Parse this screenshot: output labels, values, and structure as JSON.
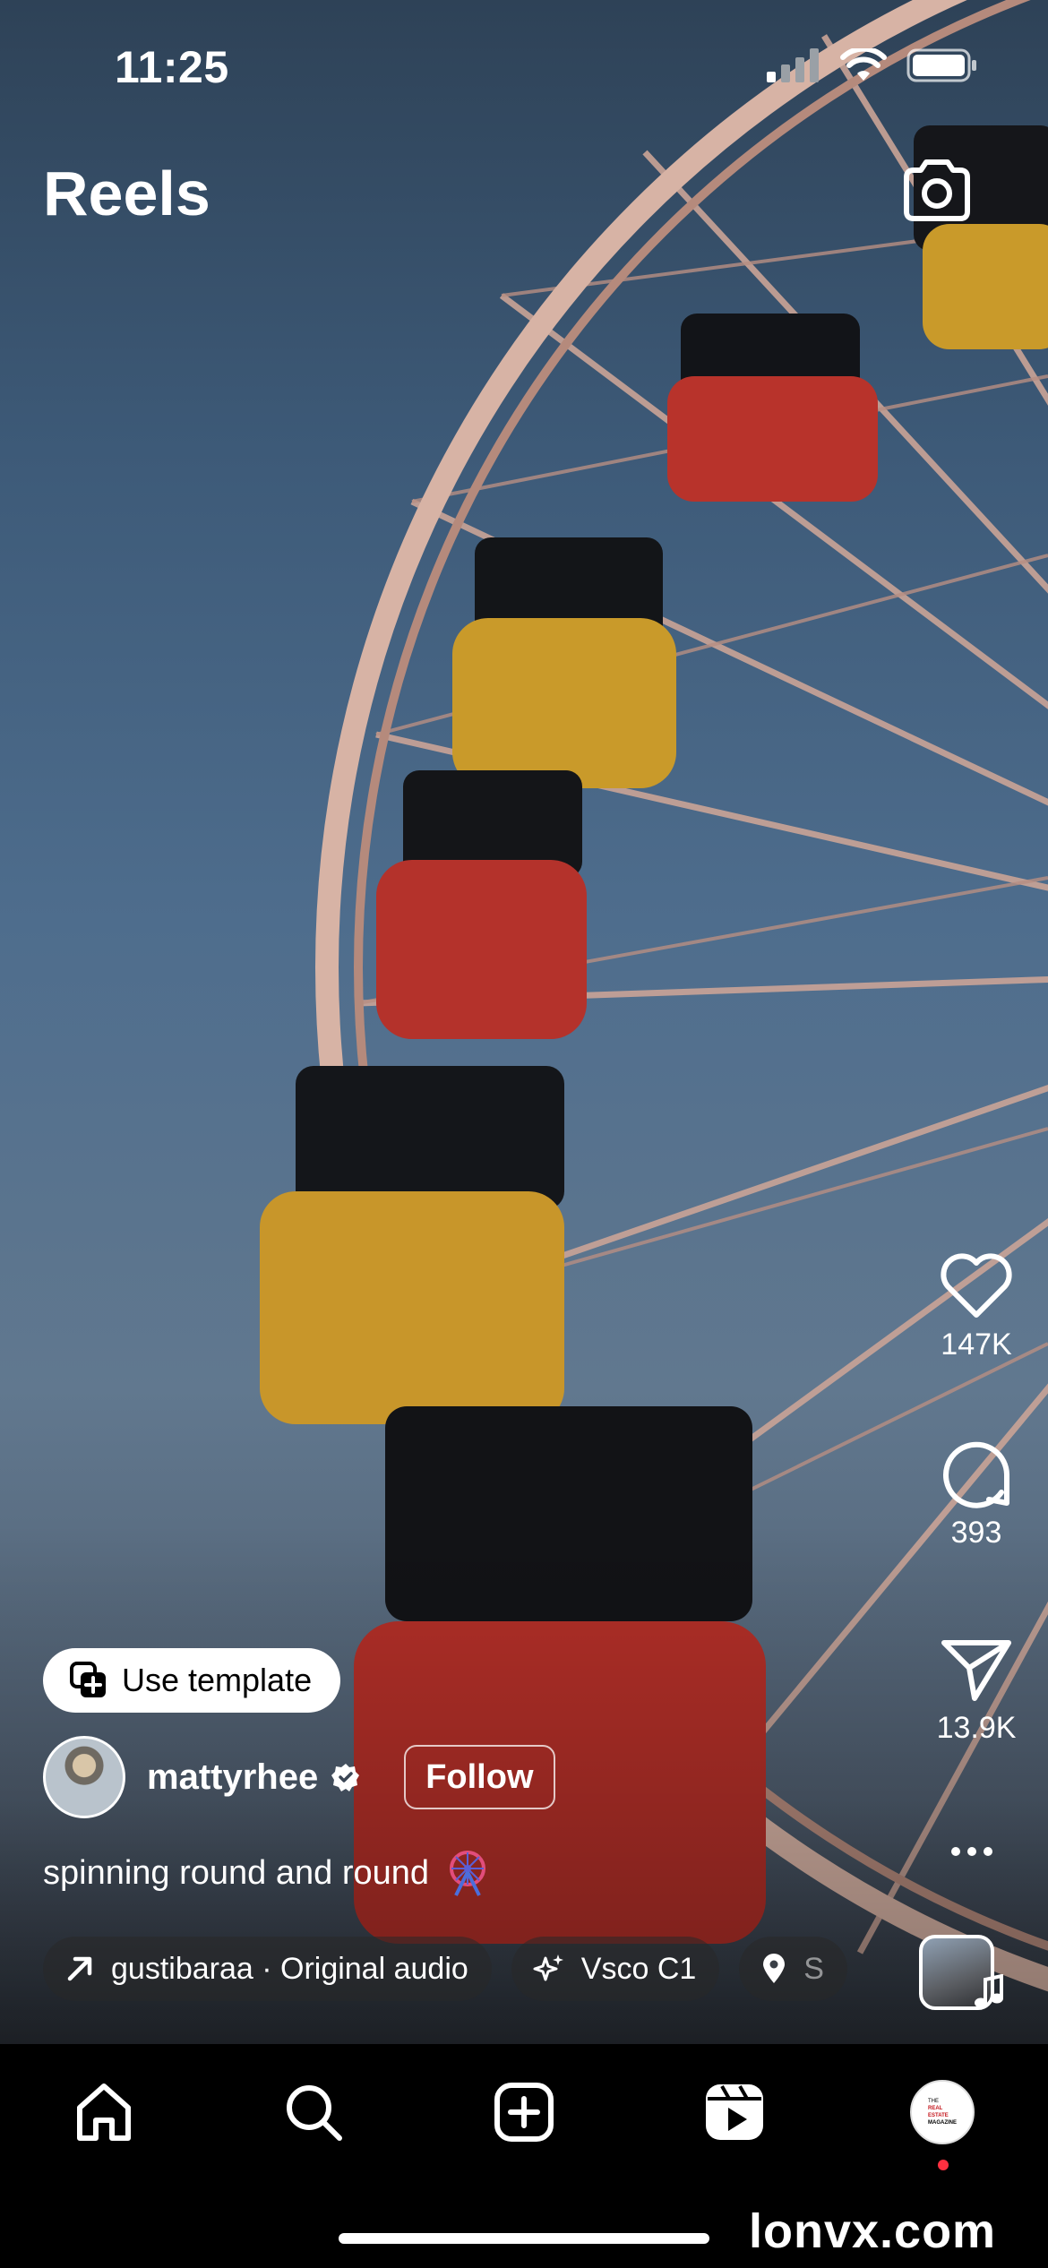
{
  "status_bar": {
    "time": "11:25"
  },
  "header": {
    "title": "Reels",
    "camera_icon": "camera-icon"
  },
  "actions": {
    "likes": "147K",
    "comments": "393",
    "shares": "13.9K"
  },
  "template_button": {
    "label": "Use template"
  },
  "author": {
    "username": "mattyrhee",
    "follow_label": "Follow"
  },
  "caption": {
    "text": "spinning round and round"
  },
  "meta_chips": [
    {
      "label": "gustibaraa · Original audio",
      "icon": "arrow-up-right-icon"
    },
    {
      "label": "Vsco C1",
      "icon": "sparkles-icon"
    },
    {
      "label": "S",
      "icon": "location-pin-icon"
    }
  ],
  "nav": {
    "items": [
      "home-icon",
      "search-icon",
      "create-icon",
      "reels-icon",
      "profile-avatar"
    ],
    "profile_text": [
      "THE",
      "REAL",
      "ESTATE",
      "MAGAZINE"
    ]
  },
  "watermark": "lonvx.com",
  "colors": {
    "accent_red": "#ff3040",
    "background": "#000000",
    "text": "#ffffff"
  }
}
